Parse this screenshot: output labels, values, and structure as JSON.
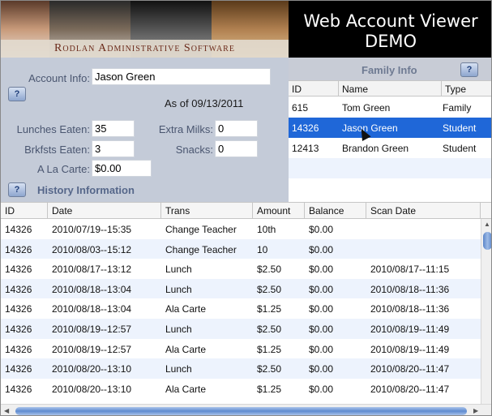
{
  "header": {
    "banner_caption": "Rodlan Administrative Software",
    "title_line1": "Web Account Viewer",
    "title_line2": "DEMO"
  },
  "account": {
    "account_info_label": "Account Info:",
    "account_info_value": "Jason  Green",
    "help_label": "?",
    "as_of": "As of 09/13/2011",
    "lunches_label": "Lunches Eaten:",
    "lunches_value": "35",
    "extra_milks_label": "Extra Milks:",
    "extra_milks_value": "0",
    "breakfasts_label": "Brkfsts Eaten:",
    "breakfasts_value": "3",
    "snacks_label": "Snacks:",
    "snacks_value": "0",
    "ala_carte_label": "A La Carte:",
    "ala_carte_value": "$0.00",
    "history_title": "History Information"
  },
  "family": {
    "title": "Family Info",
    "help_label": "?",
    "columns": [
      "ID",
      "Name",
      "Type"
    ],
    "rows": [
      {
        "id": "615",
        "name": "Tom Green",
        "type": "Family"
      },
      {
        "id": "14326",
        "name": "Jason Green",
        "type": "Student"
      },
      {
        "id": "12413",
        "name": "Brandon Green",
        "type": "Student"
      }
    ],
    "selected_row": 1
  },
  "history": {
    "columns": [
      "ID",
      "Date",
      "Trans",
      "Amount",
      "Balance",
      "Scan Date"
    ],
    "rows": [
      [
        "14326",
        "2010/07/19--15:35",
        "Change Teacher",
        "10th",
        "$0.00",
        ""
      ],
      [
        "14326",
        "2010/08/03--15:12",
        "Change Teacher",
        "10",
        "$0.00",
        ""
      ],
      [
        "14326",
        "2010/08/17--13:12",
        "Lunch",
        "$2.50",
        "$0.00",
        "2010/08/17--11:15"
      ],
      [
        "14326",
        "2010/08/18--13:04",
        "Lunch",
        "$2.50",
        "$0.00",
        "2010/08/18--11:36"
      ],
      [
        "14326",
        "2010/08/18--13:04",
        "Ala Carte",
        "$1.25",
        "$0.00",
        "2010/08/18--11:36"
      ],
      [
        "14326",
        "2010/08/19--12:57",
        "Lunch",
        "$2.50",
        "$0.00",
        "2010/08/19--11:49"
      ],
      [
        "14326",
        "2010/08/19--12:57",
        "Ala Carte",
        "$1.25",
        "$0.00",
        "2010/08/19--11:49"
      ],
      [
        "14326",
        "2010/08/20--13:10",
        "Lunch",
        "$2.50",
        "$0.00",
        "2010/08/20--11:47"
      ],
      [
        "14326",
        "2010/08/20--13:10",
        "Ala Carte",
        "$1.25",
        "$0.00",
        "2010/08/20--11:47"
      ]
    ]
  },
  "colors": {
    "selection": "#1f67d8",
    "panel": "#c4cbd8",
    "alt_row": "#edf3fd"
  }
}
